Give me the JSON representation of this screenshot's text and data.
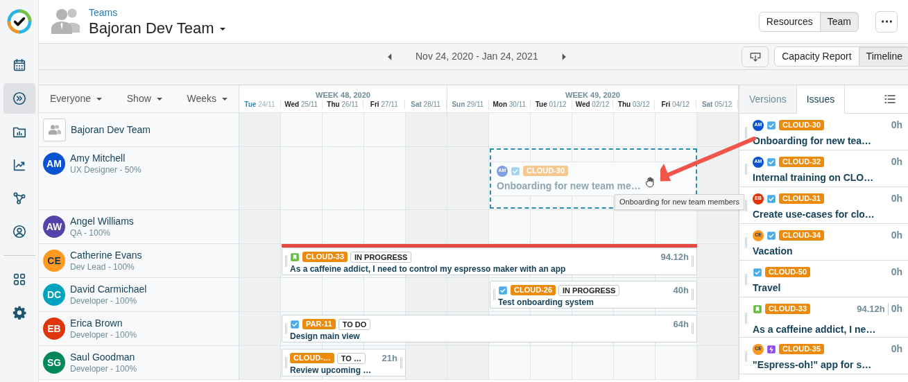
{
  "sidebar": {
    "groups": [
      [
        {
          "kind": "calendar",
          "selected": false
        },
        {
          "kind": "timeline",
          "selected": true
        },
        {
          "kind": "reports",
          "selected": false
        },
        {
          "kind": "trend",
          "selected": false
        },
        {
          "kind": "graph",
          "selected": false
        },
        {
          "kind": "user",
          "selected": false
        }
      ],
      [
        {
          "kind": "apps",
          "selected": false
        },
        {
          "kind": "settings",
          "selected": false
        }
      ]
    ]
  },
  "header": {
    "breadcrumb": "Teams",
    "title": "Bajoran Dev Team",
    "view_toggle": [
      {
        "label": "Resources",
        "selected": false
      },
      {
        "label": "Team",
        "selected": true
      }
    ]
  },
  "toolbar": {
    "date_range": "Nov 24, 2020 - Jan 24, 2021",
    "view_toggle": [
      {
        "label": "Capacity Report",
        "selected": false
      },
      {
        "label": "Timeline",
        "selected": true
      }
    ]
  },
  "planner": {
    "filters": [
      "Everyone",
      "Show",
      "Weeks"
    ],
    "weeks": [
      {
        "label": "WEEK 48, 2020",
        "days": [
          {
            "name": "Tue",
            "date": "24/11",
            "kind": "today"
          },
          {
            "name": "Wed",
            "date": "25/11",
            "kind": "workday"
          },
          {
            "name": "Thu",
            "date": "26/11",
            "kind": "workday"
          },
          {
            "name": "Fri",
            "date": "27/11",
            "kind": "workday"
          },
          {
            "name": "Sat",
            "date": "28/11",
            "kind": "weekend"
          }
        ]
      },
      {
        "label": "WEEK 49, 2020",
        "days": [
          {
            "name": "Sun",
            "date": "29/11",
            "kind": "weekend"
          },
          {
            "name": "Mon",
            "date": "30/11",
            "kind": "workday"
          },
          {
            "name": "Tue",
            "date": "01/12",
            "kind": "workday"
          },
          {
            "name": "Wed",
            "date": "02/12",
            "kind": "workday"
          },
          {
            "name": "Thu",
            "date": "03/12",
            "kind": "workday"
          },
          {
            "name": "Fri",
            "date": "04/12",
            "kind": "workday"
          },
          {
            "name": "Sat",
            "date": "05/12",
            "kind": "weekend"
          }
        ]
      }
    ],
    "rows": [
      {
        "kind": "team",
        "name": "Bajoran Dev Team"
      },
      {
        "kind": "person",
        "initials": "AM",
        "color": "#0b52d0",
        "name": "Amy Mitchell",
        "role": "UX Designer - 50%",
        "overallocated": false,
        "tasks": [],
        "drag_preview": {
          "initials": "AM",
          "color": "#7f9fe3",
          "kind": "task",
          "key": "CLOUD-30",
          "title": "Onboarding for new team me…"
        }
      },
      {
        "kind": "person",
        "initials": "AW",
        "color": "#5243aa",
        "name": "Angel Williams",
        "role": "QA - 100%",
        "overallocated": false,
        "tasks": []
      },
      {
        "kind": "person",
        "initials": "CE",
        "color": "#ff991f",
        "name": "Catherine Evans",
        "role": "Dev Lead - 100%",
        "overallocated": true,
        "tasks": [
          {
            "kind": "story",
            "key": "CLOUD-33",
            "status": "IN PROGRESS",
            "hours": "94.12h",
            "title": "As a caffeine addict, I need to control my espresso maker with an app"
          }
        ]
      },
      {
        "kind": "person",
        "initials": "DC",
        "color": "#00a3bf",
        "name": "David Carmichael",
        "role": "Developer - 100%",
        "overallocated": false,
        "tasks": [
          {
            "kind": "task",
            "key": "CLOUD-26",
            "status": "IN PROGRESS",
            "hours": "40h",
            "title": "Test onboarding system"
          }
        ]
      },
      {
        "kind": "person",
        "initials": "EB",
        "color": "#de350b",
        "name": "Erica Brown",
        "role": "Developer - 100%",
        "overallocated": false,
        "tasks": [
          {
            "kind": "task",
            "key": "PAR-11",
            "status": "TO DO",
            "hours": "64h",
            "title": "Design main view"
          }
        ]
      },
      {
        "kind": "person",
        "initials": "SG",
        "color": "#00875a",
        "name": "Saul Goodman",
        "role": "Developer - 100%",
        "overallocated": false,
        "tasks": [
          {
            "kind": "plain",
            "key": "CLOUD-…",
            "status": "TO …",
            "hours": "21h",
            "title": "Review upcoming …"
          }
        ]
      }
    ],
    "tooltip": "Onboarding for new team members"
  },
  "issues_panel": {
    "tabs": [
      {
        "label": "Versions",
        "selected": false
      },
      {
        "label": "Issues",
        "selected": true
      }
    ],
    "issues": [
      {
        "initials": "AM",
        "color": "#0b52d0",
        "kind": "task",
        "key": "CLOUD-30",
        "hours": "0h",
        "title": "Onboarding for new tea…"
      },
      {
        "initials": "AM",
        "color": "#0b52d0",
        "kind": "task",
        "key": "CLOUD-32",
        "hours": "0h",
        "title": "Internal training on CLO…"
      },
      {
        "initials": "EB",
        "color": "#de350b",
        "kind": "task",
        "key": "CLOUD-31",
        "hours": "0h",
        "title": "Create use-cases for clo…"
      },
      {
        "initials": "CE",
        "color": "#ff991f",
        "kind": "task",
        "key": "CLOUD-34",
        "hours": "0h",
        "title": "Vacation"
      },
      {
        "kind": "task",
        "key": "CLOUD-50",
        "hours": "0h",
        "title": "Travel"
      },
      {
        "kind": "story",
        "key": "CLOUD-33",
        "estimate": "94.12h",
        "hours": "0h",
        "title": "As a caffeine addict, I ne…"
      },
      {
        "initials": "CE",
        "color": "#ff991f",
        "kind": "epic",
        "key": "CLOUD-35",
        "hours": "0h",
        "title": "\"Espress-oh!\" app for s…"
      }
    ]
  }
}
